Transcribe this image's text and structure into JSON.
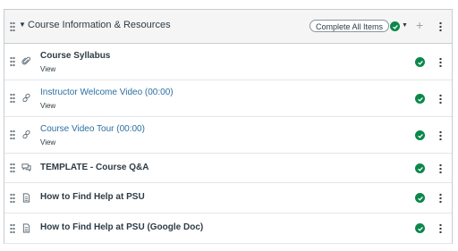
{
  "module": {
    "title": "Course Information & Resources",
    "complete_all_label": "Complete All Items",
    "status_color": "#0b874b",
    "items": [
      {
        "title": "Course Syllabus",
        "subtitle": "View",
        "icon": "paperclip-icon",
        "style": "bold"
      },
      {
        "title": "Instructor Welcome Video (00:00)",
        "subtitle": "View",
        "icon": "link-icon",
        "style": "link"
      },
      {
        "title": "Course Video Tour (00:00)",
        "subtitle": "View",
        "icon": "link-icon",
        "style": "link"
      },
      {
        "title": "TEMPLATE - Course Q&A",
        "subtitle": "",
        "icon": "discussion-icon",
        "style": "bold"
      },
      {
        "title": "How to Find Help at PSU",
        "subtitle": "",
        "icon": "page-icon",
        "style": "bold"
      },
      {
        "title": "How to Find Help at PSU (Google Doc)",
        "subtitle": "",
        "icon": "page-icon",
        "style": "bold"
      }
    ]
  }
}
